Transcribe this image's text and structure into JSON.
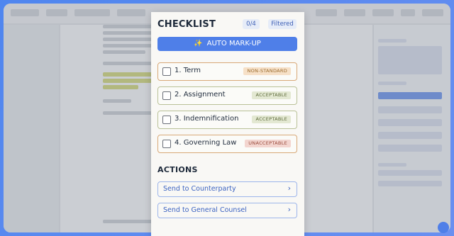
{
  "checklist": {
    "title": "CHECKLIST",
    "count": "0/4",
    "filter_label": "Filtered",
    "auto_markup_label": "AUTO MARK-UP",
    "items": [
      {
        "label": "1. Term",
        "status": "NON-STANDARD"
      },
      {
        "label": "2. Assignment",
        "status": "ACCEPTABLE"
      },
      {
        "label": "3. Indemnification",
        "status": "ACCEPTABLE"
      },
      {
        "label": "4. Governing Law",
        "status": "UNACCEPTABLE"
      }
    ]
  },
  "actions": {
    "title": "ACTIONS",
    "items": [
      {
        "label": "Send to Counterparty"
      },
      {
        "label": "Send to General Counsel"
      }
    ]
  },
  "colors": {
    "accent": "#4f7fe8",
    "non_standard": "#d8a877",
    "acceptable": "#b9c197",
    "unacceptable": "#d9a193"
  },
  "icons": {
    "auto_markup": "magic-wand-icon",
    "action_arrow": "chevron-right-icon",
    "item_checkbox": "checkbox-icon"
  }
}
